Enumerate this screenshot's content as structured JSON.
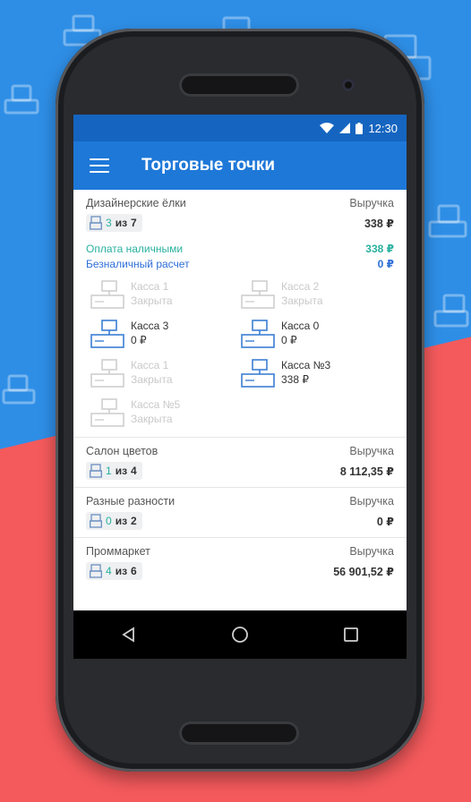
{
  "status_bar": {
    "time": "12:30"
  },
  "app_bar": {
    "title": "Торговые точки"
  },
  "stores": [
    {
      "name": "Дизайнерские ёлки",
      "revenue_label": "Выручка",
      "revenue": "338 ₽",
      "open_count": "3",
      "sep": "из",
      "total_count": "7",
      "payments": [
        {
          "label": "Оплата наличными",
          "value": "338 ₽",
          "kind": "cash"
        },
        {
          "label": "Безналичный расчет",
          "value": "0 ₽",
          "kind": "card"
        }
      ],
      "registers": [
        {
          "name": "Касса 1",
          "status": "Закрыта",
          "active": false
        },
        {
          "name": "Касса 2",
          "status": "Закрыта",
          "active": false
        },
        {
          "name": "Касса 3",
          "status": "0 ₽",
          "active": true
        },
        {
          "name": "Касса 0",
          "status": "0 ₽",
          "active": true
        },
        {
          "name": "Касса 1",
          "status": "Закрыта",
          "active": false
        },
        {
          "name": "Касса №3",
          "status": "338 ₽",
          "active": true
        },
        {
          "name": "Касса №5",
          "status": "Закрыта",
          "active": false
        }
      ]
    },
    {
      "name": "Салон цветов",
      "revenue_label": "Выручка",
      "revenue": "8 112,35 ₽",
      "open_count": "1",
      "sep": "из",
      "total_count": "4"
    },
    {
      "name": "Разные разности",
      "revenue_label": "Выручка",
      "revenue": "0 ₽",
      "open_count": "0",
      "sep": "из",
      "total_count": "2"
    },
    {
      "name": "Проммаркет",
      "revenue_label": "Выручка",
      "revenue": "56 901,52 ₽",
      "open_count": "4",
      "sep": "из",
      "total_count": "6"
    }
  ],
  "icons": {
    "menu": "menu-icon",
    "wifi": "wifi-icon",
    "signal": "signal-icon",
    "battery": "battery-icon",
    "register": "cash-register-icon",
    "back": "back-icon",
    "home": "home-icon",
    "recent": "recent-apps-icon"
  },
  "colors": {
    "app_bar": "#1e78d8",
    "status_bar": "#1565c0",
    "cash": "#2ab0a0",
    "card": "#2e6fd6",
    "bg_blue": "#2e8ee6",
    "bg_red": "#f45a5c"
  }
}
